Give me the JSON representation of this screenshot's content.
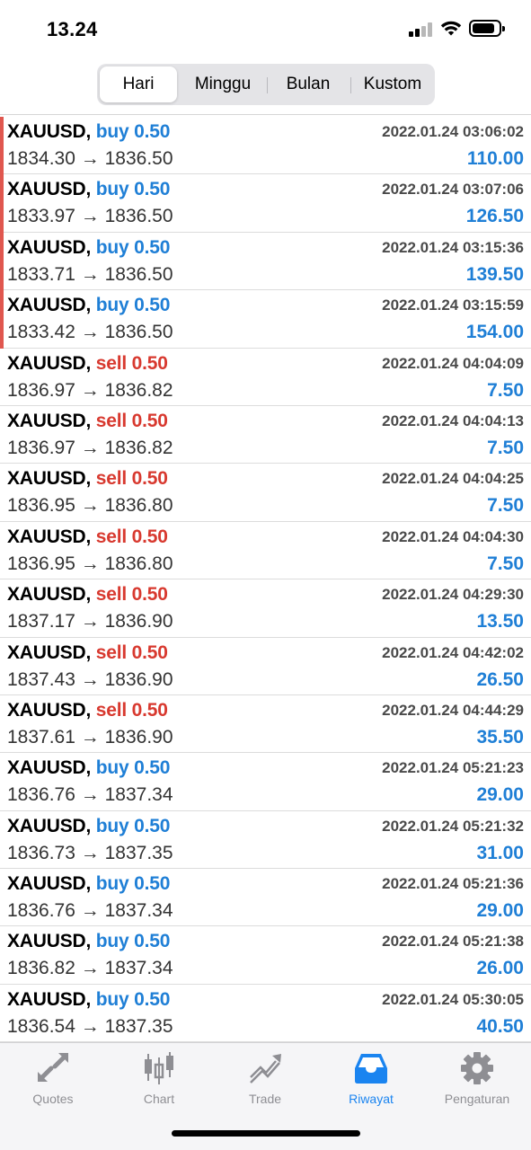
{
  "status_bar": {
    "time": "13.24"
  },
  "tabs_period": [
    {
      "label": "Hari",
      "active": true
    },
    {
      "label": "Minggu",
      "active": false
    },
    {
      "label": "Bulan",
      "active": false
    },
    {
      "label": "Kustom",
      "active": false
    }
  ],
  "trades": [
    {
      "symbol": "XAUUSD,",
      "side": "buy",
      "volume": "0.50",
      "open": "1834.30",
      "arrow": "→",
      "close": "1836.50",
      "date": "2022.01.24 03:06:02",
      "profit": "110.00",
      "marker": true
    },
    {
      "symbol": "XAUUSD,",
      "side": "buy",
      "volume": "0.50",
      "open": "1833.97",
      "arrow": "→",
      "close": "1836.50",
      "date": "2022.01.24 03:07:06",
      "profit": "126.50",
      "marker": true
    },
    {
      "symbol": "XAUUSD,",
      "side": "buy",
      "volume": "0.50",
      "open": "1833.71",
      "arrow": "→",
      "close": "1836.50",
      "date": "2022.01.24 03:15:36",
      "profit": "139.50",
      "marker": true
    },
    {
      "symbol": "XAUUSD,",
      "side": "buy",
      "volume": "0.50",
      "open": "1833.42",
      "arrow": "→",
      "close": "1836.50",
      "date": "2022.01.24 03:15:59",
      "profit": "154.00",
      "marker": true
    },
    {
      "symbol": "XAUUSD,",
      "side": "sell",
      "volume": "0.50",
      "open": "1836.97",
      "arrow": "→",
      "close": "1836.82",
      "date": "2022.01.24 04:04:09",
      "profit": "7.50",
      "marker": false
    },
    {
      "symbol": "XAUUSD,",
      "side": "sell",
      "volume": "0.50",
      "open": "1836.97",
      "arrow": "→",
      "close": "1836.82",
      "date": "2022.01.24 04:04:13",
      "profit": "7.50",
      "marker": false
    },
    {
      "symbol": "XAUUSD,",
      "side": "sell",
      "volume": "0.50",
      "open": "1836.95",
      "arrow": "→",
      "close": "1836.80",
      "date": "2022.01.24 04:04:25",
      "profit": "7.50",
      "marker": false
    },
    {
      "symbol": "XAUUSD,",
      "side": "sell",
      "volume": "0.50",
      "open": "1836.95",
      "arrow": "→",
      "close": "1836.80",
      "date": "2022.01.24 04:04:30",
      "profit": "7.50",
      "marker": false
    },
    {
      "symbol": "XAUUSD,",
      "side": "sell",
      "volume": "0.50",
      "open": "1837.17",
      "arrow": "→",
      "close": "1836.90",
      "date": "2022.01.24 04:29:30",
      "profit": "13.50",
      "marker": false
    },
    {
      "symbol": "XAUUSD,",
      "side": "sell",
      "volume": "0.50",
      "open": "1837.43",
      "arrow": "→",
      "close": "1836.90",
      "date": "2022.01.24 04:42:02",
      "profit": "26.50",
      "marker": false
    },
    {
      "symbol": "XAUUSD,",
      "side": "sell",
      "volume": "0.50",
      "open": "1837.61",
      "arrow": "→",
      "close": "1836.90",
      "date": "2022.01.24 04:44:29",
      "profit": "35.50",
      "marker": false
    },
    {
      "symbol": "XAUUSD,",
      "side": "buy",
      "volume": "0.50",
      "open": "1836.76",
      "arrow": "→",
      "close": "1837.34",
      "date": "2022.01.24 05:21:23",
      "profit": "29.00",
      "marker": false
    },
    {
      "symbol": "XAUUSD,",
      "side": "buy",
      "volume": "0.50",
      "open": "1836.73",
      "arrow": "→",
      "close": "1837.35",
      "date": "2022.01.24 05:21:32",
      "profit": "31.00",
      "marker": false
    },
    {
      "symbol": "XAUUSD,",
      "side": "buy",
      "volume": "0.50",
      "open": "1836.76",
      "arrow": "→",
      "close": "1837.34",
      "date": "2022.01.24 05:21:36",
      "profit": "29.00",
      "marker": false
    },
    {
      "symbol": "XAUUSD,",
      "side": "buy",
      "volume": "0.50",
      "open": "1836.82",
      "arrow": "→",
      "close": "1837.34",
      "date": "2022.01.24 05:21:38",
      "profit": "26.00",
      "marker": false
    },
    {
      "symbol": "XAUUSD,",
      "side": "buy",
      "volume": "0.50",
      "open": "1836.54",
      "arrow": "→",
      "close": "1837.35",
      "date": "2022.01.24 05:30:05",
      "profit": "40.50",
      "marker": false
    }
  ],
  "tabbar": [
    {
      "label": "Quotes",
      "icon": "quotes-arrows-icon",
      "active": false
    },
    {
      "label": "Chart",
      "icon": "candlestick-icon",
      "active": false
    },
    {
      "label": "Trade",
      "icon": "trade-trend-icon",
      "active": false
    },
    {
      "label": "Riwayat",
      "icon": "inbox-tray-icon",
      "active": true
    },
    {
      "label": "Pengaturan",
      "icon": "gear-icon",
      "active": false
    }
  ],
  "colors": {
    "buy": "#1f7fd6",
    "sell": "#d8392f",
    "profit": "#1f7fd6",
    "active_tab": "#1a84f0",
    "marker": "#e0574f"
  }
}
